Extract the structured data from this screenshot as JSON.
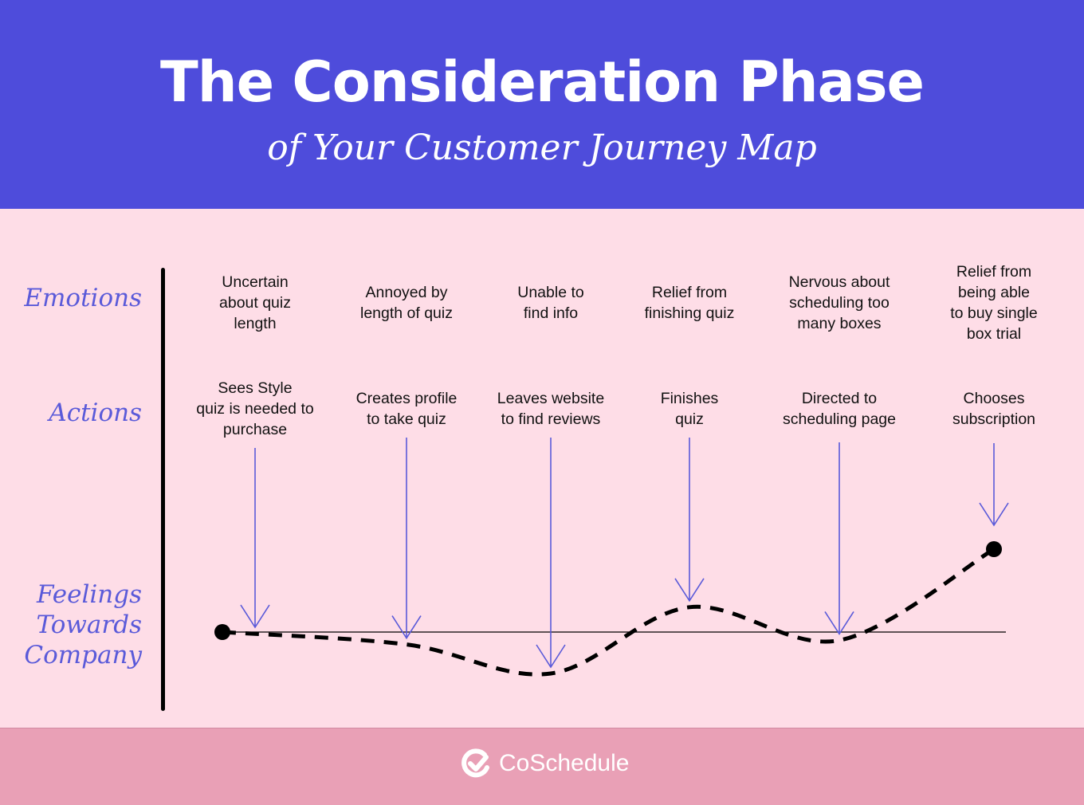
{
  "header": {
    "title": "The Consideration Phase",
    "subtitle": "of Your Customer Journey Map"
  },
  "rows": {
    "emotions": "Emotions",
    "actions": "Actions",
    "feelings": [
      "Feelings",
      "Towards",
      "Company"
    ]
  },
  "colors": {
    "header_bg": "#4e4cdb",
    "body_bg": "#fedde7",
    "footer_bg": "#e9a0b6",
    "label_color": "#5a5ad9",
    "arrow_color": "#5a5ad9"
  },
  "stages": [
    {
      "emotion": [
        "Uncertain",
        "about quiz",
        "length"
      ],
      "action": [
        "Sees Style",
        "quiz is needed to",
        "purchase"
      ],
      "feeling": 0
    },
    {
      "emotion": [
        "Annoyed by",
        "length of quiz"
      ],
      "action": [
        "Creates profile",
        "to take quiz"
      ],
      "feeling": -0.3
    },
    {
      "emotion": [
        "Unable to",
        "find info"
      ],
      "action": [
        "Leaves website",
        "to find reviews"
      ],
      "feeling": -1
    },
    {
      "emotion": [
        "Relief from",
        "finishing quiz"
      ],
      "action": [
        "Finishes",
        "quiz"
      ],
      "feeling": 0.6
    },
    {
      "emotion": [
        "Nervous about",
        "scheduling too",
        "many boxes"
      ],
      "action": [
        "Directed to",
        "scheduling page"
      ],
      "feeling": -0.2
    },
    {
      "emotion": [
        "Relief from",
        "being able",
        "to buy single",
        "box trial"
      ],
      "action": [
        "Chooses",
        "subscription"
      ],
      "feeling": 2
    }
  ],
  "footer": {
    "brand": "CoSchedule",
    "logo_icon": "check-circle-icon"
  }
}
